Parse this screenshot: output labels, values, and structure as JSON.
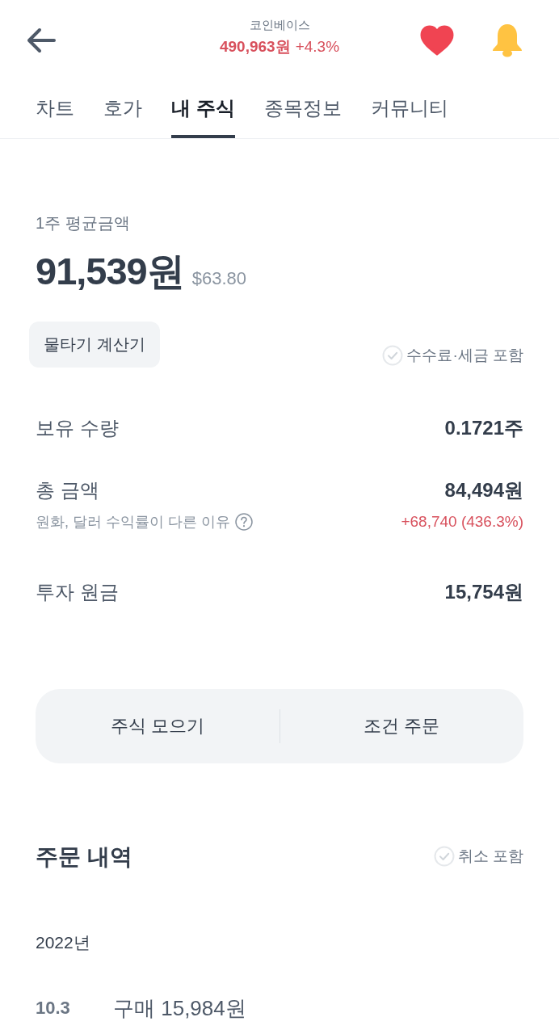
{
  "header": {
    "stock_name": "코인베이스",
    "price": "490,963원",
    "change": "+4.3%",
    "favorited": true
  },
  "tabs": [
    {
      "label": "차트",
      "selected": false
    },
    {
      "label": "호가",
      "selected": false
    },
    {
      "label": "내 주식",
      "selected": true
    },
    {
      "label": "종목정보",
      "selected": false
    },
    {
      "label": "커뮤니티",
      "selected": false
    }
  ],
  "summary": {
    "label": "1주 평균금액",
    "price_krw": "91,539원",
    "price_usd": "$63.80"
  },
  "calculator_button": "물타기 계산기",
  "fee_option": {
    "label": "수수료·세금 포함",
    "checked": false
  },
  "holdings": [
    {
      "label": "보유 수량",
      "value": "0.1721주"
    },
    {
      "label": "총 금액",
      "value": "84,494원",
      "note": "원화, 달러 수익률이 다른 이유",
      "profit": "+68,740 (436.3%)"
    },
    {
      "label": "투자 원금",
      "value": "15,754원"
    }
  ],
  "actions": [
    "주식 모으기",
    "조건 주문"
  ],
  "orders": {
    "title": "주문 내역",
    "cancel_option": {
      "label": "취소 포함",
      "checked": false
    },
    "groups": [
      {
        "year": "2022년",
        "items": [
          {
            "date": "10.3",
            "description": "구매 15,984원"
          }
        ]
      }
    ]
  }
}
